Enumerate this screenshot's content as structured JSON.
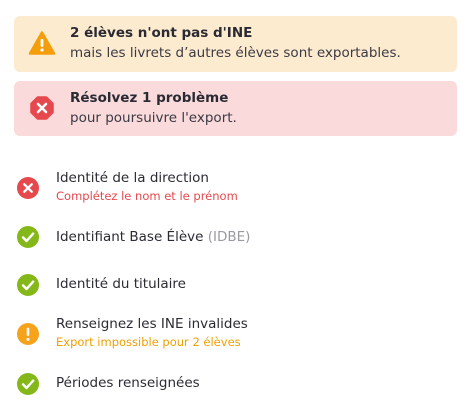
{
  "colors": {
    "warning_bg": "#fdebd0",
    "warning_icon": "#f59e0b",
    "error_bg": "#fadadb",
    "error_icon": "#e5484d",
    "success_icon": "#84b818",
    "warning_circle": "#f7a21b"
  },
  "alerts": {
    "warning": {
      "icon": "warning-triangle-icon",
      "title": "2 élèves n'ont pas d'INE",
      "subtitle": "mais les livrets d’autres élèves sont exportables."
    },
    "error": {
      "icon": "error-octagon-icon",
      "title": "Résolvez 1 problème",
      "subtitle": "pour poursuivre l'export."
    }
  },
  "checklist": [
    {
      "status": "error",
      "icon": "error-circle-icon",
      "label": "Identité de la direction",
      "sublabel": "Complétez le nom et le prénom"
    },
    {
      "status": "success",
      "icon": "check-circle-icon",
      "label": "Identifiant Base Élève",
      "label_suffix": "(IDBE)"
    },
    {
      "status": "success",
      "icon": "check-circle-icon",
      "label": "Identité du titulaire"
    },
    {
      "status": "warning",
      "icon": "exclamation-circle-icon",
      "label": "Renseignez les INE invalides",
      "sublabel": "Export impossible pour 2 élèves"
    },
    {
      "status": "success",
      "icon": "check-circle-icon",
      "label": "Périodes renseignées"
    }
  ]
}
